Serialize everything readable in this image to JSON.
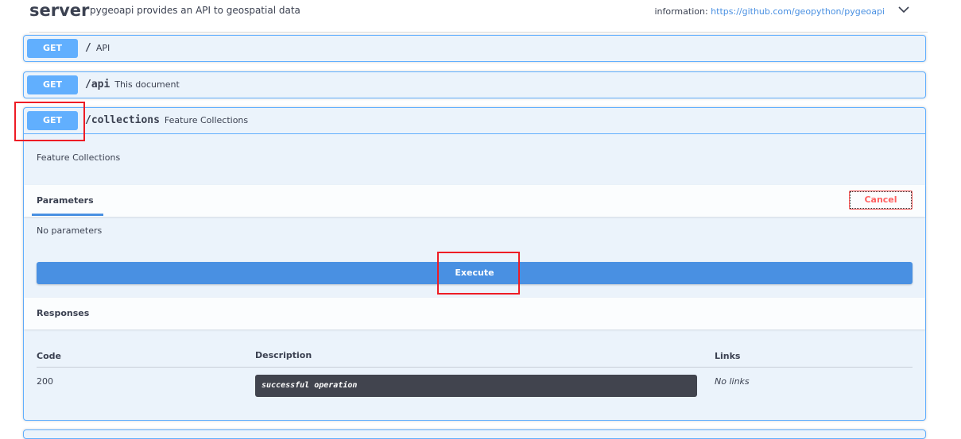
{
  "tag": {
    "title": "server",
    "description": "pygeoapi provides an API to geospatial data",
    "info_label": "information:",
    "info_link": "https://github.com/geopython/pygeoapi",
    "chevron_icon": "chevron-down-icon"
  },
  "operations": [
    {
      "method": "GET",
      "path": "/",
      "summary": "API"
    },
    {
      "method": "GET",
      "path": "/api",
      "summary": "This document"
    },
    {
      "method": "GET",
      "path": "/collections",
      "summary": "Feature Collections"
    }
  ],
  "expanded": {
    "description": "Feature Collections",
    "parameters_title": "Parameters",
    "cancel_label": "Cancel",
    "no_parameters": "No parameters",
    "execute_label": "Execute",
    "responses_title": "Responses",
    "columns": {
      "code": "Code",
      "description": "Description",
      "links": "Links"
    },
    "responses": [
      {
        "code": "200",
        "description": "successful operation",
        "links": "No links"
      }
    ]
  },
  "colors": {
    "get_accent": "#61affe",
    "execute": "#4990e2",
    "cancel": "#ff6060",
    "highlight": "#ee1c25"
  }
}
